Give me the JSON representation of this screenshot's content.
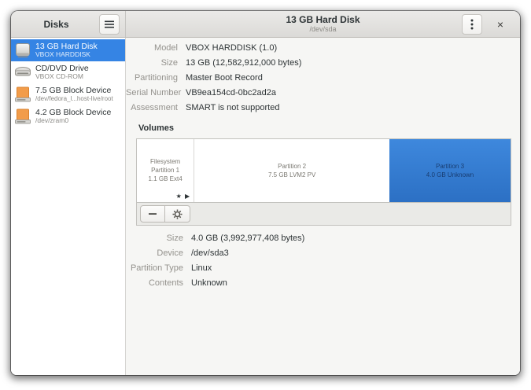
{
  "sidebar_header": {
    "title": "Disks"
  },
  "header": {
    "title": "13 GB Hard Disk",
    "subtitle": "/dev/sda"
  },
  "sidebar": {
    "items": [
      {
        "title": "13 GB Hard Disk",
        "subtitle": "VBOX HARDDISK",
        "icon": "hard-disk",
        "selected": true
      },
      {
        "title": "CD/DVD Drive",
        "subtitle": "VBOX CD-ROM",
        "icon": "optical-drive",
        "selected": false
      },
      {
        "title": "7.5 GB Block Device",
        "subtitle": "/dev/fedora_l...host-live/root",
        "icon": "block-device",
        "selected": false
      },
      {
        "title": "4.2 GB Block Device",
        "subtitle": "/dev/zram0",
        "icon": "block-device",
        "selected": false
      }
    ]
  },
  "drive_info": {
    "rows": [
      {
        "label": "Model",
        "value": "VBOX HARDDISK (1.0)"
      },
      {
        "label": "Size",
        "value": "13 GB (12,582,912,000 bytes)"
      },
      {
        "label": "Partitioning",
        "value": "Master Boot Record"
      },
      {
        "label": "Serial Number",
        "value": "VB9ea154cd-0bc2ad2a"
      },
      {
        "label": "Assessment",
        "value": "SMART is not supported"
      }
    ]
  },
  "volumes": {
    "heading": "Volumes",
    "partitions": [
      {
        "line1": "Filesystem",
        "line2": "Partition 1",
        "line3": "1.1 GB Ext4",
        "flags": "★ ▶",
        "selected": false
      },
      {
        "line1": "Partition 2",
        "line2": "7.5 GB LVM2 PV",
        "selected": false
      },
      {
        "line1": "Partition 3",
        "line2": "4.0 GB Unknown",
        "selected": true
      }
    ]
  },
  "volume_info": {
    "rows": [
      {
        "label": "Size",
        "value": "4.0 GB (3,992,977,408 bytes)"
      },
      {
        "label": "Device",
        "value": "/dev/sda3"
      },
      {
        "label": "Partition Type",
        "value": "Linux"
      },
      {
        "label": "Contents",
        "value": "Unknown"
      }
    ]
  },
  "glyphs": {
    "close": "×"
  },
  "colors": {
    "accent": "#3584e4",
    "partition_selected": "#3382d8",
    "block_device_orange": "#f29c4a"
  }
}
